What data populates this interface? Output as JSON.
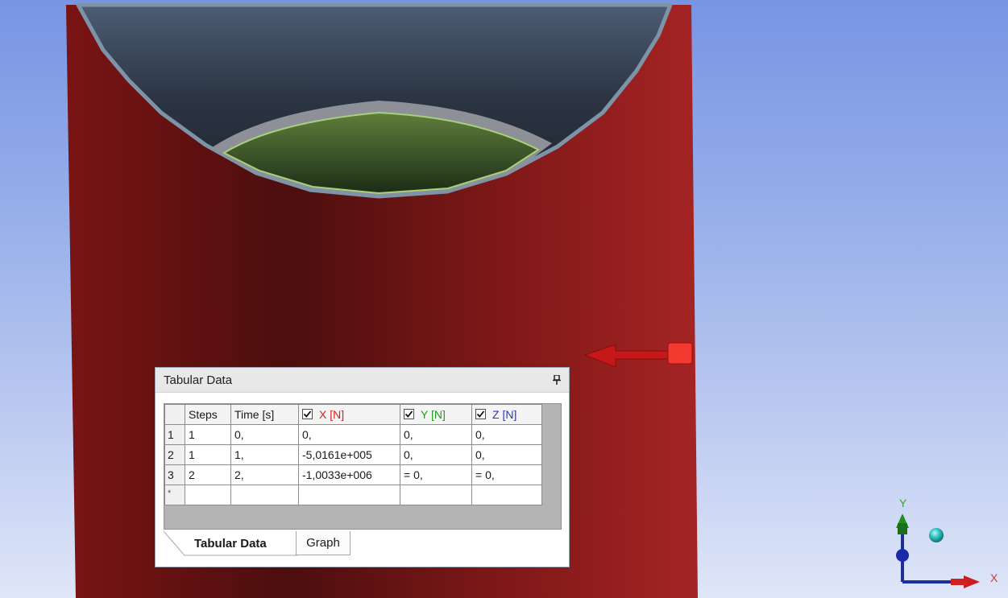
{
  "panel": {
    "title": "Tabular Data",
    "pin_icon": "pin-icon",
    "table": {
      "headers": {
        "rownum": "",
        "steps": "Steps",
        "time": "Time [s]",
        "x": "X [N]",
        "y": "Y [N]",
        "z": "Z [N]"
      },
      "checked": {
        "x": true,
        "y": true,
        "z": true
      },
      "rows": [
        {
          "num": "1",
          "steps": "1",
          "time": "0,",
          "x": "0,",
          "y": "0,",
          "z": "0,"
        },
        {
          "num": "2",
          "steps": "1",
          "time": "1,",
          "x": "-5,0161e+005",
          "y": "0,",
          "z": "0,"
        },
        {
          "num": "3",
          "steps": "2",
          "time": "2,",
          "x": "-1,0033e+006",
          "y": "= 0,",
          "z": "= 0,"
        }
      ],
      "new_row_marker": "*"
    },
    "tabs": [
      {
        "label": "Tabular Data",
        "active": true
      },
      {
        "label": "Graph",
        "active": false
      }
    ]
  },
  "triad": {
    "x_label": "X",
    "y_label": "Y"
  },
  "colors": {
    "cylinder": "#8c1a1a",
    "force_arrow": "#e02020",
    "x_series": "#d61f1f",
    "y_series": "#239b23",
    "z_series": "#2b33c8"
  }
}
